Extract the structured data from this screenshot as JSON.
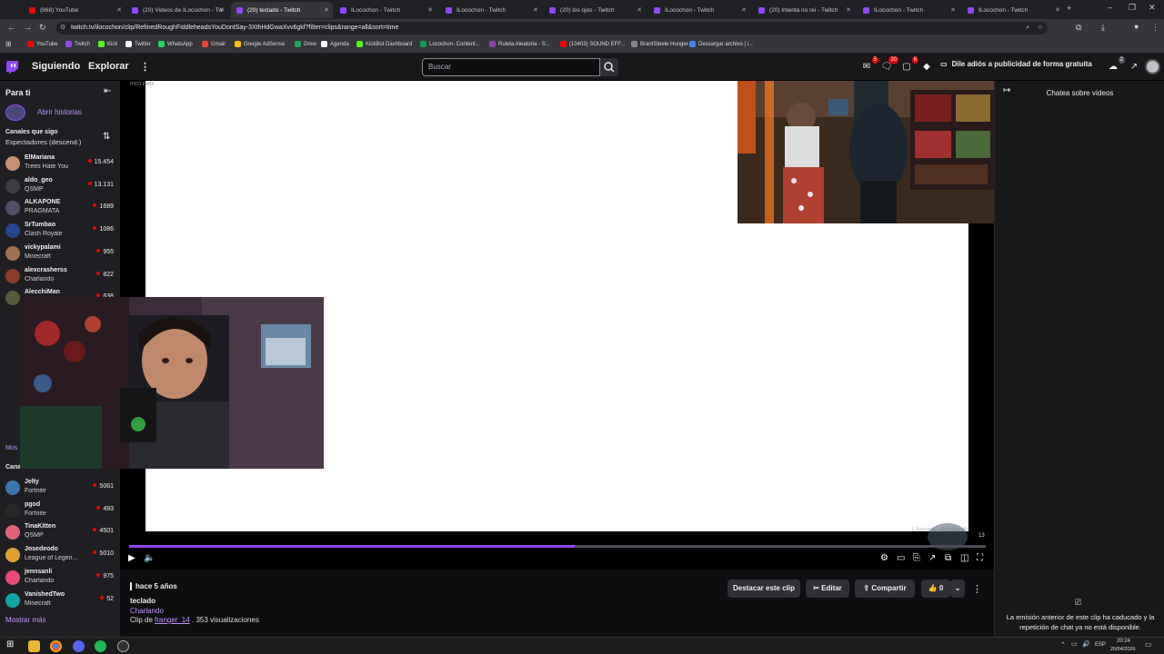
{
  "browser": {
    "tabs": [
      {
        "label": "(868) YouTube",
        "color": "#ff0000"
      },
      {
        "label": "(20) Videos de ILocochon - Tw",
        "color": "#9147ff"
      },
      {
        "label": "(20) teclado - Twitch",
        "color": "#9147ff"
      },
      {
        "label": "ILocochon - Twitch",
        "color": "#9147ff"
      },
      {
        "label": "ILocochon - Twitch",
        "color": "#9147ff"
      },
      {
        "label": "(20) los ojos - Twitch",
        "color": "#9147ff"
      },
      {
        "label": "ILocochon - Twitch",
        "color": "#9147ff"
      },
      {
        "label": "(20) Intenta no rei - Twitch",
        "color": "#9147ff"
      },
      {
        "label": "ILocochon - Twitch",
        "color": "#9147ff"
      },
      {
        "label": "ILocochon - Twitch",
        "color": "#9147ff"
      }
    ],
    "url": "twitch.tv/ilocochon/clip/RefinedRoughFiddleheadsYouDontSay-3XthHdGwaXvv6gkf?filter=clips&range=all&sort=time",
    "bookmarks": [
      {
        "label": "YouTube",
        "color": "#ff0000"
      },
      {
        "label": "Twitch",
        "color": "#9147ff"
      },
      {
        "label": "Kick",
        "color": "#53fc18"
      },
      {
        "label": "Twitter",
        "color": "#ffffff"
      },
      {
        "label": "WhatsApp",
        "color": "#25d366"
      },
      {
        "label": "Gmail",
        "color": "#ea4335"
      },
      {
        "label": "Google AdSense",
        "color": "#fbbc04"
      },
      {
        "label": "Drive",
        "color": "#1fa463"
      },
      {
        "label": "Agenda",
        "color": "#ffffff"
      },
      {
        "label": "KickBot Dashboard",
        "color": "#53fc18"
      },
      {
        "label": "Locochon- Content...",
        "color": "#0f9d58"
      },
      {
        "label": "Ruleta Aleatoria - S...",
        "color": "#8e44ad"
      },
      {
        "label": "(10403) SOUND EFF...",
        "color": "#ff0000"
      },
      {
        "label": "BrantSteele Hunger...",
        "color": "#888888"
      },
      {
        "label": "Descargar archivo | i...",
        "color": "#4285f4"
      }
    ]
  },
  "topnav": {
    "following": "Siguiendo",
    "explore": "Explorar",
    "search_placeholder": "Buscar",
    "badge_inbox": "5",
    "badge_notifications": "20",
    "badge_whispers": "6",
    "badge_friends": "2",
    "adsfree": "Dile adiós a publicidad de forma gratuita"
  },
  "sidebar": {
    "for_you": "Para ti",
    "stories": "Abrir historias",
    "followed_title": "Canales que sigo",
    "followed_sort": "Espectadores (descend.)",
    "followed": [
      {
        "name": "ElMariana",
        "game": "Trees Hate You",
        "viewers": "15.454",
        "color": "#c89070"
      },
      {
        "name": "aldo_geo",
        "game": "QSMP",
        "viewers": "13.131",
        "color": "#3c3c46"
      },
      {
        "name": "ALKAPONE",
        "game": "PRAGMATA",
        "viewers": "1689",
        "color": "#50506a"
      },
      {
        "name": "SrTumbao",
        "game": "Clash Royale",
        "viewers": "1086",
        "color": "#26468c"
      },
      {
        "name": "vickypalami",
        "game": "Minecraft",
        "viewers": "955",
        "color": "#a07050"
      },
      {
        "name": "alexcrasherss",
        "game": "Charlando",
        "viewers": "822",
        "color": "#8c3c2a"
      },
      {
        "name": "AlecchiMan",
        "game": "",
        "viewers": "638",
        "color": "#5a5a3c"
      }
    ],
    "show_more_partial": "Mos",
    "live_title": "Canales en directo",
    "live": [
      {
        "name": "Jelty",
        "game": "Fortnite",
        "viewers": "5061",
        "color": "#3a78b4"
      },
      {
        "name": "pgod",
        "game": "Fortnite",
        "viewers": "493",
        "color": "#282828"
      },
      {
        "name": "TinaKitten",
        "game": "QSMP",
        "viewers": "4501",
        "color": "#e06478"
      },
      {
        "name": "Josedeodo",
        "game": "League of Legen...",
        "viewers": "5010",
        "color": "#e0a030"
      },
      {
        "name": "jennsanli",
        "game": "Charlando",
        "viewers": "975",
        "color": "#e84a7a"
      },
      {
        "name": "VanishedTwo",
        "game": "Minecraft",
        "viewers": "52",
        "color": "#12a4a4"
      }
    ],
    "show_more": "Mostrar más"
  },
  "player": {
    "game_tag": "PICO PARK",
    "progress": 0.52,
    "watermark": "Lhanon - Acaba de"
  },
  "clip": {
    "time_ago": "hace 5 años",
    "title": "teclado",
    "category": "Charlando",
    "clip_by": "Clip de",
    "author": "franger_14",
    "views": ". 353 visualizaciones",
    "highlight": "Destacar este clip",
    "edit": "Editar",
    "share": "Compartir",
    "likes": "0"
  },
  "chat": {
    "title": "Chatea sobre vídeos",
    "expired_msg": "La emisión anterior de este clip ha caducado y la repetición de chat ya no está disponible."
  },
  "taskbar": {
    "lang": "ESP",
    "time": "20:24",
    "date": "20/04/2026"
  }
}
